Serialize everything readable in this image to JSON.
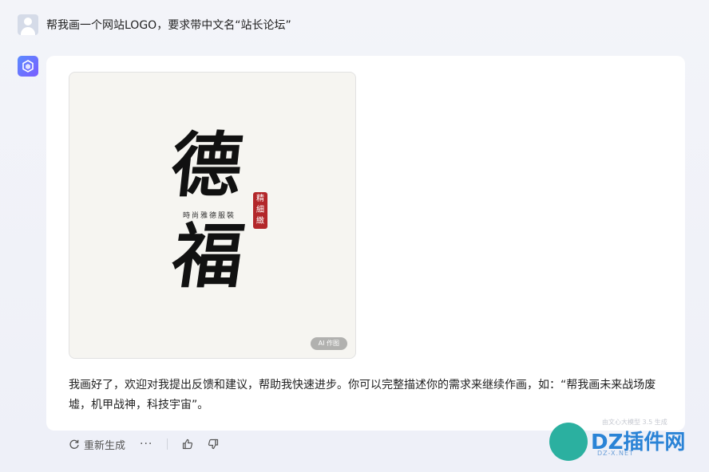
{
  "user": {
    "prompt": "帮我画一个网站LOGO，要求带中文名“站长论坛”"
  },
  "artwork": {
    "glyph_top": "德",
    "glyph_bottom": "福",
    "small_text": "時尚雅德服裝",
    "seal_text": "精細緻",
    "badge": "AI 作图"
  },
  "reply": {
    "text": "我画好了，欢迎对我提出反馈和建议，帮助我快速进步。你可以完整描述你的需求来继续作画，如：“帮我画未来战场废墟，机甲战神，科技宇宙”。",
    "model_note": "由文心大模型 3.5 生成"
  },
  "actions": {
    "regenerate_label": "重新生成",
    "more_label": "···"
  },
  "watermark": {
    "title": "DZ插件网",
    "subtitle": "DZ-X.NET"
  },
  "colors": {
    "bot_accent": "#5b8cff",
    "seal": "#b3272a",
    "watermark_blue": "#2a83d6",
    "watermark_teal": "#2bb0a0"
  }
}
